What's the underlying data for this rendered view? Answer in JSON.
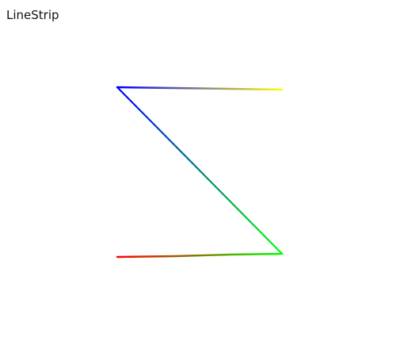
{
  "window": {
    "title": "LineStrip"
  },
  "colors": {
    "background": "#ffffff",
    "text": "#111111",
    "red": "#ff0000",
    "green": "#00ff00",
    "blue": "#0000ff",
    "yellow": "#ffff00"
  }
}
